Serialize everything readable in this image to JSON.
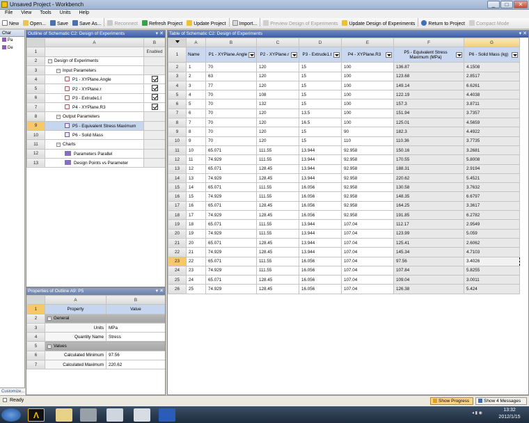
{
  "window": {
    "title": "Unsaved Project - Workbench",
    "min": "_",
    "max": "□",
    "close": "✕"
  },
  "menu": [
    "File",
    "View",
    "Tools",
    "Units",
    "Help"
  ],
  "toolbar": {
    "new": "New",
    "open": "Open...",
    "save": "Save",
    "save_as": "Save As...",
    "reconnect": "Reconnect",
    "refresh": "Refresh Project",
    "update": "Update Project",
    "import": "Import...",
    "preview": "Preview Design of Experiments",
    "update_doe": "Update Design of Experiments",
    "return": "Return to Project",
    "compact": "Compact Mode"
  },
  "toolbox": {
    "header": "Char",
    "items": [
      "Pa",
      "De"
    ],
    "customize": "Customize..."
  },
  "outline": {
    "title": "Outline of Schematic C2: Design of Experiments",
    "col_a": "A",
    "col_b": "B",
    "enabled": "Enabled",
    "rows": [
      {
        "n": "2",
        "label": "Design of Experiments",
        "indent": 0,
        "exp": "−"
      },
      {
        "n": "3",
        "label": "Input Parameters",
        "indent": 1,
        "exp": "−"
      },
      {
        "n": "4",
        "label": "P1 - XYPlane.Angle",
        "indent": 2,
        "icon": "param-input-icon",
        "check": true
      },
      {
        "n": "5",
        "label": "P2 - XYPlane.r",
        "indent": 2,
        "icon": "param-input-icon",
        "check": true
      },
      {
        "n": "6",
        "label": "P3 - Extrude1.t",
        "indent": 2,
        "icon": "param-input-icon",
        "check": true
      },
      {
        "n": "7",
        "label": "P4 - XYPlane.R3",
        "indent": 2,
        "icon": "param-input-icon",
        "check": true
      },
      {
        "n": "8",
        "label": "Output Parameters",
        "indent": 1,
        "exp": "−"
      },
      {
        "n": "9",
        "label": "P5 - Equivalent Stress Maximum",
        "indent": 2,
        "icon": "param-output-icon",
        "selected": true
      },
      {
        "n": "10",
        "label": "P6 - Solid Mass",
        "indent": 2,
        "icon": "param-output-icon"
      },
      {
        "n": "11",
        "label": "Charts",
        "indent": 1,
        "exp": "−"
      },
      {
        "n": "12",
        "label": "Parameters Parallel",
        "indent": 2,
        "icon": "chart-icon"
      },
      {
        "n": "13",
        "label": "Design Points vs Parameter",
        "indent": 2,
        "icon": "chart-icon"
      }
    ]
  },
  "props": {
    "title": "Properties of Outline A9: P5",
    "col_a": "A",
    "col_b": "B",
    "h1": "Property",
    "h2": "Value",
    "rows": [
      {
        "n": "2",
        "type": "group",
        "label": "General"
      },
      {
        "n": "3",
        "label": "Units",
        "value": "MPa"
      },
      {
        "n": "4",
        "label": "Quantity Name",
        "value": "Stress"
      },
      {
        "n": "5",
        "type": "group",
        "label": "Values"
      },
      {
        "n": "6",
        "label": "Calculated Minimum",
        "value": "97.56"
      },
      {
        "n": "7",
        "label": "Calculated Maximum",
        "value": "220.62"
      }
    ]
  },
  "doe": {
    "title": "Table of Schematic C2: Design of Experiments",
    "cols": [
      "A",
      "B",
      "C",
      "D",
      "E",
      "F",
      "G"
    ],
    "headers": [
      "Name",
      "P1 - XYPlane.Angle",
      "P2 - XYPlane.r",
      "P3 - Extrude1.t",
      "P4 - XYPlane.R3",
      "P5 - Equivalent Stress Maximum (MPa)",
      "P6 - Solid Mass (kg)"
    ],
    "rows": [
      [
        "1",
        "70",
        "120",
        "15",
        "100",
        "136.87",
        "4.1508"
      ],
      [
        "2",
        "63",
        "120",
        "15",
        "100",
        "123.68",
        "2.8517"
      ],
      [
        "3",
        "77",
        "120",
        "15",
        "100",
        "149.14",
        "6.6261"
      ],
      [
        "4",
        "70",
        "108",
        "15",
        "100",
        "122.19",
        "4.4038"
      ],
      [
        "5",
        "70",
        "132",
        "15",
        "100",
        "157.3",
        "3.8711"
      ],
      [
        "6",
        "70",
        "120",
        "13.5",
        "100",
        "151.94",
        "3.7357"
      ],
      [
        "7",
        "70",
        "120",
        "16.5",
        "100",
        "125.01",
        "4.5659"
      ],
      [
        "8",
        "70",
        "120",
        "15",
        "90",
        "182.3",
        "4.4922"
      ],
      [
        "9",
        "70",
        "120",
        "15",
        "110",
        "110.36",
        "3.7735"
      ],
      [
        "10",
        "65.071",
        "111.55",
        "13.944",
        "92.958",
        "150.16",
        "3.2681"
      ],
      [
        "11",
        "74.929",
        "111.55",
        "13.944",
        "92.958",
        "170.55",
        "5.8008"
      ],
      [
        "12",
        "65.071",
        "128.45",
        "13.944",
        "92.958",
        "188.31",
        "2.9194"
      ],
      [
        "13",
        "74.929",
        "128.45",
        "13.944",
        "92.958",
        "220.62",
        "5.4521"
      ],
      [
        "14",
        "65.071",
        "111.55",
        "16.056",
        "92.958",
        "130.58",
        "3.7632"
      ],
      [
        "15",
        "74.929",
        "111.55",
        "16.056",
        "92.958",
        "148.35",
        "6.6797"
      ],
      [
        "16",
        "65.071",
        "128.45",
        "16.056",
        "92.958",
        "164.25",
        "3.3617"
      ],
      [
        "17",
        "74.929",
        "128.45",
        "16.056",
        "92.958",
        "191.85",
        "6.2782"
      ],
      [
        "18",
        "65.071",
        "111.55",
        "13.944",
        "107.04",
        "112.17",
        "2.9549"
      ],
      [
        "19",
        "74.929",
        "111.55",
        "13.944",
        "107.04",
        "123.99",
        "5.059"
      ],
      [
        "20",
        "65.071",
        "128.45",
        "13.944",
        "107.04",
        "125.41",
        "2.6062"
      ],
      [
        "21",
        "74.929",
        "128.45",
        "13.944",
        "107.04",
        "145.34",
        "4.7103"
      ],
      [
        "22",
        "65.071",
        "111.55",
        "16.056",
        "107.04",
        "97.56",
        "3.4026"
      ],
      [
        "23",
        "74.929",
        "111.55",
        "16.056",
        "107.04",
        "107.84",
        "5.8255"
      ],
      [
        "24",
        "65.071",
        "128.45",
        "16.056",
        "107.04",
        "109.04",
        "3.0011"
      ],
      [
        "25",
        "74.929",
        "128.45",
        "16.056",
        "107.04",
        "126.38",
        "5.424"
      ]
    ]
  },
  "status": {
    "text": "Ready",
    "show_progress": "Show Progress",
    "show_messages": "Show 4 Messages"
  },
  "taskbar": {
    "time": "13:32",
    "date": "2012/1/15"
  }
}
